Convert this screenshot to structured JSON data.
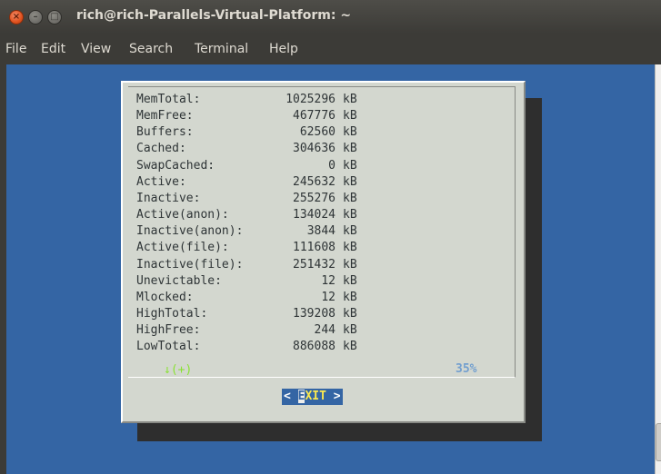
{
  "window": {
    "title": "rich@rich-Parallels-Virtual-Platform: ~",
    "close_glyph": "×",
    "minimize_glyph": "–",
    "maximize_glyph": "□"
  },
  "menu": {
    "items": [
      "File",
      "Edit",
      "View",
      "Search",
      "Terminal",
      "Help"
    ]
  },
  "meminfo": {
    "rows": [
      {
        "label": "MemTotal:",
        "value": "1025296",
        "unit": "kB"
      },
      {
        "label": "MemFree:",
        "value": "467776",
        "unit": "kB"
      },
      {
        "label": "Buffers:",
        "value": "62560",
        "unit": "kB"
      },
      {
        "label": "Cached:",
        "value": "304636",
        "unit": "kB"
      },
      {
        "label": "SwapCached:",
        "value": "0",
        "unit": "kB"
      },
      {
        "label": "Active:",
        "value": "245632",
        "unit": "kB"
      },
      {
        "label": "Inactive:",
        "value": "255276",
        "unit": "kB"
      },
      {
        "label": "Active(anon):",
        "value": "134024",
        "unit": "kB"
      },
      {
        "label": "Inactive(anon):",
        "value": "3844",
        "unit": "kB"
      },
      {
        "label": "Active(file):",
        "value": "111608",
        "unit": "kB"
      },
      {
        "label": "Inactive(file):",
        "value": "251432",
        "unit": "kB"
      },
      {
        "label": "Unevictable:",
        "value": "12",
        "unit": "kB"
      },
      {
        "label": "Mlocked:",
        "value": "12",
        "unit": "kB"
      },
      {
        "label": "HighTotal:",
        "value": "139208",
        "unit": "kB"
      },
      {
        "label": "HighFree:",
        "value": "244",
        "unit": "kB"
      },
      {
        "label": "LowTotal:",
        "value": "886088",
        "unit": "kB"
      }
    ],
    "scroll_indicator": "↓(+)",
    "percent": "35%"
  },
  "exit_button": {
    "prefix": "< ",
    "hotkey": "E",
    "rest": "XIT",
    "suffix": " >"
  },
  "colors": {
    "terminal_bg": "#3465a4",
    "dialog_bg": "#d3d7cf",
    "dialog_shadow": "#2e2e2e",
    "indicator_green": "#8ae234",
    "percent_blue": "#729fcf",
    "button_bg": "#3465a4",
    "button_text": "#fce94f"
  }
}
